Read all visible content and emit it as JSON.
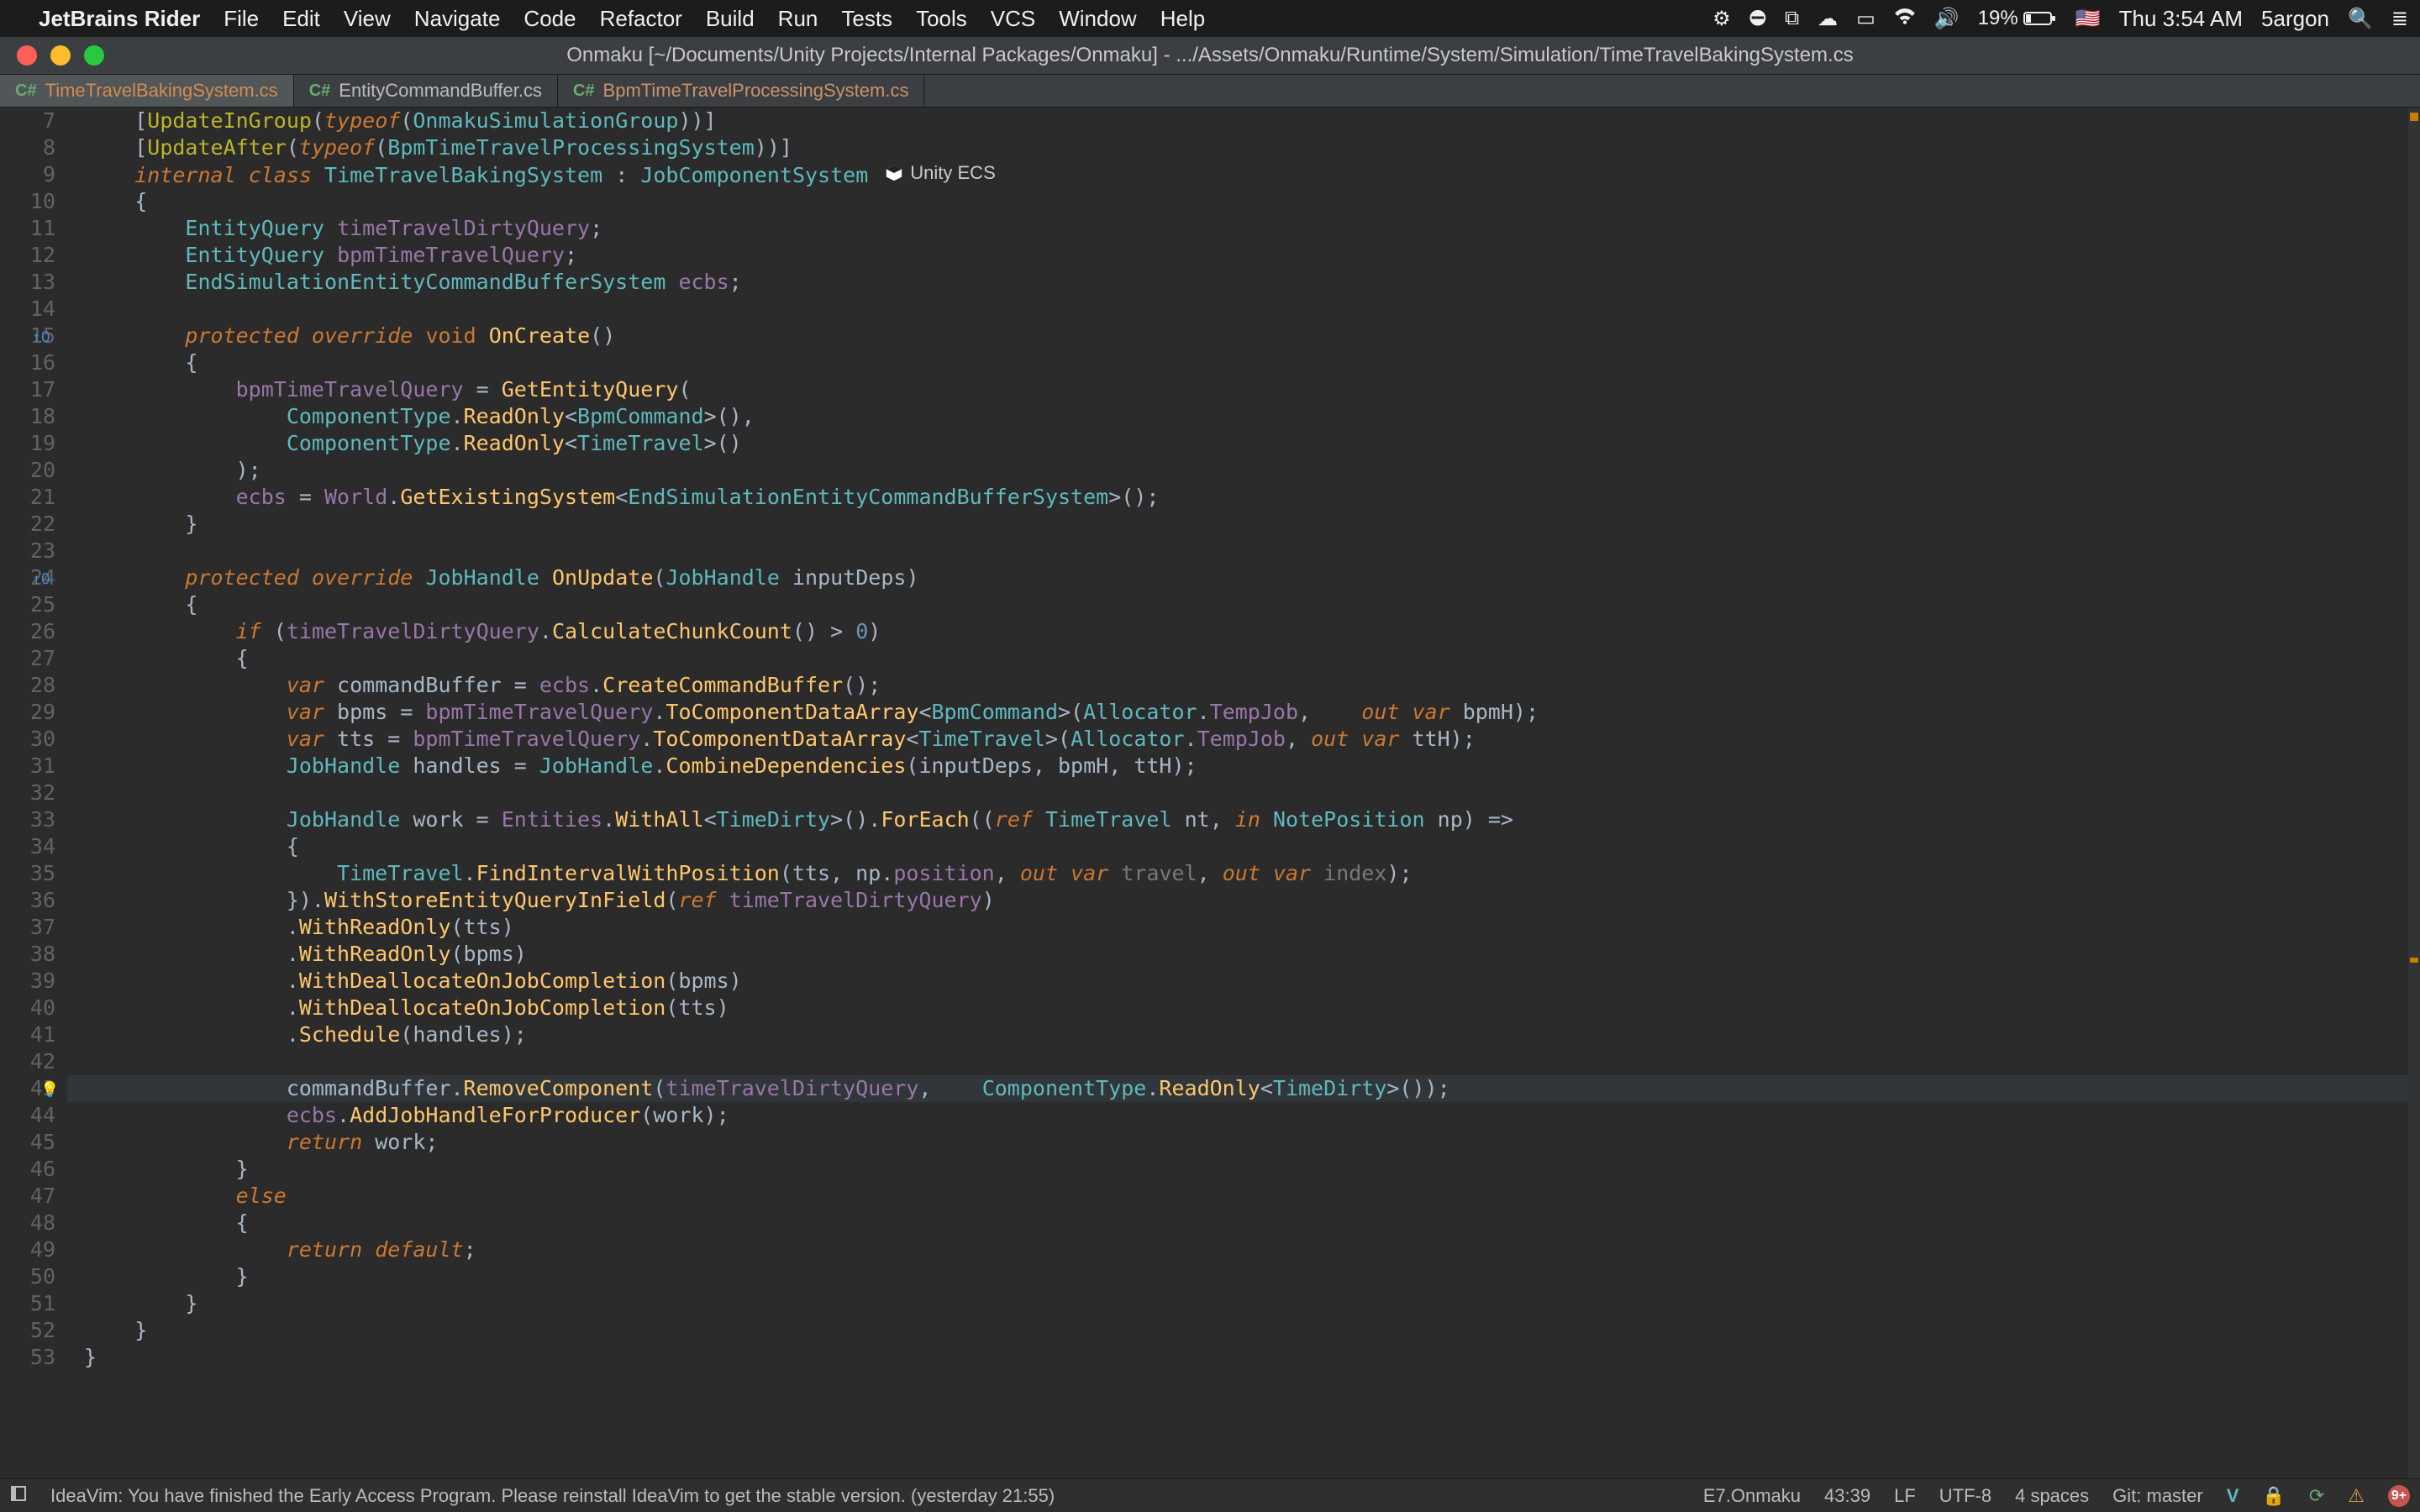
{
  "menubar": {
    "app": "JetBrains Rider",
    "items": [
      "File",
      "Edit",
      "View",
      "Navigate",
      "Code",
      "Refactor",
      "Build",
      "Run",
      "Tests",
      "Tools",
      "VCS",
      "Window",
      "Help"
    ],
    "battery_pct": "19%",
    "clock": "Thu 3:54 AM",
    "user": "5argon"
  },
  "window": {
    "title": "Onmaku [~/Documents/Unity Projects/Internal Packages/Onmaku] - .../Assets/Onmaku/Runtime/System/Simulation/TimeTravelBakingSystem.cs"
  },
  "tabs": [
    {
      "lang": "C#",
      "name": "TimeTravelBakingSystem.cs"
    },
    {
      "lang": "C#",
      "name": "EntityCommandBuffer.cs"
    },
    {
      "lang": "C#",
      "name": "BpmTimeTravelProcessingSystem.cs"
    }
  ],
  "ecs_label": "Unity ECS",
  "gutter": {
    "start": 7,
    "end": 53,
    "marks": [
      15,
      24
    ],
    "highlight_line": 43,
    "bulb_line": 43
  },
  "code_lines": [
    {
      "n": 7,
      "t": [
        "  [",
        "ann:UpdateInGroup",
        "def:(",
        "kwItalic:typeof",
        "def:(",
        "ty:OnmakuSimulationGroup",
        "def:))]"
      ]
    },
    {
      "n": 8,
      "t": [
        "  [",
        "ann:UpdateAfter",
        "def:(",
        "kwItalic:typeof",
        "def:(",
        "ty:BpmTimeTravelProcessingSystem",
        "def:))]"
      ]
    },
    {
      "n": 9,
      "t": [
        "  ",
        "kwItalic:internal",
        " ",
        "kwItalic:class",
        " ",
        "ty:TimeTravelBakingSystem",
        " : ",
        "ty:JobComponentSystem",
        "ecsbadge:"
      ]
    },
    {
      "n": 10,
      "t": [
        "  {"
      ]
    },
    {
      "n": 11,
      "t": [
        "    ",
        "ty:EntityQuery",
        " ",
        "fd:timeTravelDirtyQuery",
        ";"
      ]
    },
    {
      "n": 12,
      "t": [
        "    ",
        "ty:EntityQuery",
        " ",
        "fd:bpmTimeTravelQuery",
        ";"
      ]
    },
    {
      "n": 13,
      "t": [
        "    ",
        "ty:EndSimulationEntityCommandBufferSystem",
        " ",
        "fd:ecbs",
        ";"
      ]
    },
    {
      "n": 14,
      "t": [
        ""
      ]
    },
    {
      "n": 15,
      "t": [
        "    ",
        "kwItalic:protected",
        " ",
        "kwItalic:override",
        " ",
        "kw:void",
        " ",
        "mt:OnCreate",
        "()"
      ]
    },
    {
      "n": 16,
      "t": [
        "    {"
      ]
    },
    {
      "n": 17,
      "t": [
        "      ",
        "fd:bpmTimeTravelQuery",
        " = ",
        "mt:GetEntityQuery",
        "("
      ]
    },
    {
      "n": 18,
      "t": [
        "        ",
        "ty:ComponentType",
        ".",
        "mt:ReadOnly",
        "<",
        "ty:BpmCommand",
        ">(),"
      ]
    },
    {
      "n": 19,
      "t": [
        "        ",
        "ty:ComponentType",
        ".",
        "mt:ReadOnly",
        "<",
        "ty:TimeTravel",
        ">()"
      ]
    },
    {
      "n": 20,
      "t": [
        "      );"
      ]
    },
    {
      "n": 21,
      "t": [
        "      ",
        "fd:ecbs",
        " = ",
        "fd:World",
        ".",
        "mt:GetExistingSystem",
        "<",
        "ty:EndSimulationEntityCommandBufferSystem",
        ">();"
      ]
    },
    {
      "n": 22,
      "t": [
        "    }"
      ]
    },
    {
      "n": 23,
      "t": [
        ""
      ]
    },
    {
      "n": 24,
      "t": [
        "    ",
        "kwItalic:protected",
        " ",
        "kwItalic:override",
        " ",
        "ty:JobHandle",
        " ",
        "mt:OnUpdate",
        "(",
        "ty:JobHandle",
        " ",
        "pm:inputDeps",
        ")"
      ]
    },
    {
      "n": 25,
      "t": [
        "    {"
      ]
    },
    {
      "n": 26,
      "t": [
        "      ",
        "kwItalic:if",
        " (",
        "fd:timeTravelDirtyQuery",
        ".",
        "mt:CalculateChunkCount",
        "() > ",
        "nm:0",
        ")"
      ]
    },
    {
      "n": 27,
      "t": [
        "      {"
      ]
    },
    {
      "n": 28,
      "t": [
        "        ",
        "kwItalic:var",
        " commandBuffer = ",
        "fd:ecbs",
        ".",
        "mt:CreateCommandBuffer",
        "();"
      ]
    },
    {
      "n": 29,
      "t": [
        "        ",
        "kwItalic:var",
        " bpms = ",
        "fd:bpmTimeTravelQuery",
        ".",
        "mt:ToComponentDataArray",
        "<",
        "ty:BpmCommand",
        ">(",
        "ty:Allocator",
        ".",
        "fd:TempJob",
        ",  ",
        "kwItalic:out",
        " ",
        "kwItalic:var",
        " bpmH);"
      ]
    },
    {
      "n": 30,
      "t": [
        "        ",
        "kwItalic:var",
        " tts = ",
        "fd:bpmTimeTravelQuery",
        ".",
        "mt:ToComponentDataArray",
        "<",
        "ty:TimeTravel",
        ">(",
        "ty:Allocator",
        ".",
        "fd:TempJob",
        ", ",
        "kwItalic:out",
        " ",
        "kwItalic:var",
        " ttH);"
      ]
    },
    {
      "n": 31,
      "t": [
        "        ",
        "ty:JobHandle",
        " handles = ",
        "ty:JobHandle",
        ".",
        "mt:CombineDependencies",
        "(inputDeps, bpmH, ttH);"
      ]
    },
    {
      "n": 32,
      "t": [
        ""
      ]
    },
    {
      "n": 33,
      "t": [
        "        ",
        "ty:JobHandle",
        " work = ",
        "fd:Entities",
        ".",
        "mt:WithAll",
        "<",
        "ty:TimeDirty",
        ">().",
        "mt:ForEach",
        "((",
        "kwItalic:ref",
        " ",
        "ty:TimeTravel",
        " ",
        "pm:nt",
        ", ",
        "kwItalic:in",
        " ",
        "ty:NotePosition",
        " ",
        "pm:np",
        ") =>"
      ]
    },
    {
      "n": 34,
      "t": [
        "        {"
      ]
    },
    {
      "n": 35,
      "t": [
        "          ",
        "ty:TimeTravel",
        ".",
        "mt:FindIntervalWithPosition",
        "(tts, ",
        "pm:np",
        ".",
        "fd:position",
        ", ",
        "kwItalic:out",
        " ",
        "kwItalic:var",
        " ",
        "lbl:travel",
        ", ",
        "kwItalic:out",
        " ",
        "kwItalic:var",
        " ",
        "lbl:index",
        ");"
      ]
    },
    {
      "n": 36,
      "t": [
        "        }).",
        "mt:WithStoreEntityQueryInField",
        "(",
        "kwItalic:ref",
        " ",
        "fd:timeTravelDirtyQuery",
        ")"
      ]
    },
    {
      "n": 37,
      "t": [
        "        .",
        "mt:WithReadOnly",
        "(tts)"
      ]
    },
    {
      "n": 38,
      "t": [
        "        .",
        "mt:WithReadOnly",
        "(bpms)"
      ]
    },
    {
      "n": 39,
      "t": [
        "        .",
        "mt:WithDeallocateOnJobCompletion",
        "(bpms)"
      ]
    },
    {
      "n": 40,
      "t": [
        "        .",
        "mt:WithDeallocateOnJobCompletion",
        "(tts)"
      ]
    },
    {
      "n": 41,
      "t": [
        "        .",
        "mt:Schedule",
        "(handles);"
      ]
    },
    {
      "n": 42,
      "t": [
        ""
      ]
    },
    {
      "n": 43,
      "hl": true,
      "t": [
        "        commandBuffer.",
        "mt:RemoveComponent",
        "(",
        "fd:timeTravelDirtyQuery",
        ",  ",
        "ty:ComponentType",
        ".",
        "mt:ReadOnly",
        "<",
        "ty:TimeDirty",
        ">());"
      ]
    },
    {
      "n": 44,
      "t": [
        "        ",
        "fd:ecbs",
        ".",
        "mt:AddJobHandleForProducer",
        "(work);"
      ]
    },
    {
      "n": 45,
      "t": [
        "        ",
        "kwItalic:return",
        " work;"
      ]
    },
    {
      "n": 46,
      "t": [
        "      }"
      ]
    },
    {
      "n": 47,
      "t": [
        "      ",
        "kwItalic:else"
      ]
    },
    {
      "n": 48,
      "t": [
        "      {"
      ]
    },
    {
      "n": 49,
      "t": [
        "        ",
        "kwItalic:return",
        " ",
        "kwItalic:default",
        ";"
      ]
    },
    {
      "n": 50,
      "t": [
        "      }"
      ]
    },
    {
      "n": 51,
      "t": [
        "    }"
      ]
    },
    {
      "n": 52,
      "t": [
        "  }"
      ]
    },
    {
      "n": 53,
      "t": [
        "}"
      ]
    }
  ],
  "statusbar": {
    "msg": "IdeaVim: You have finished the Early Access Program. Please reinstall IdeaVim to get the stable version. (yesterday 21:55)",
    "context": "E7.Onmaku",
    "caret": "43:39",
    "eol": "LF",
    "encoding": "UTF-8",
    "indent": "4 spaces",
    "git": "Git: master",
    "badge": "9+"
  }
}
